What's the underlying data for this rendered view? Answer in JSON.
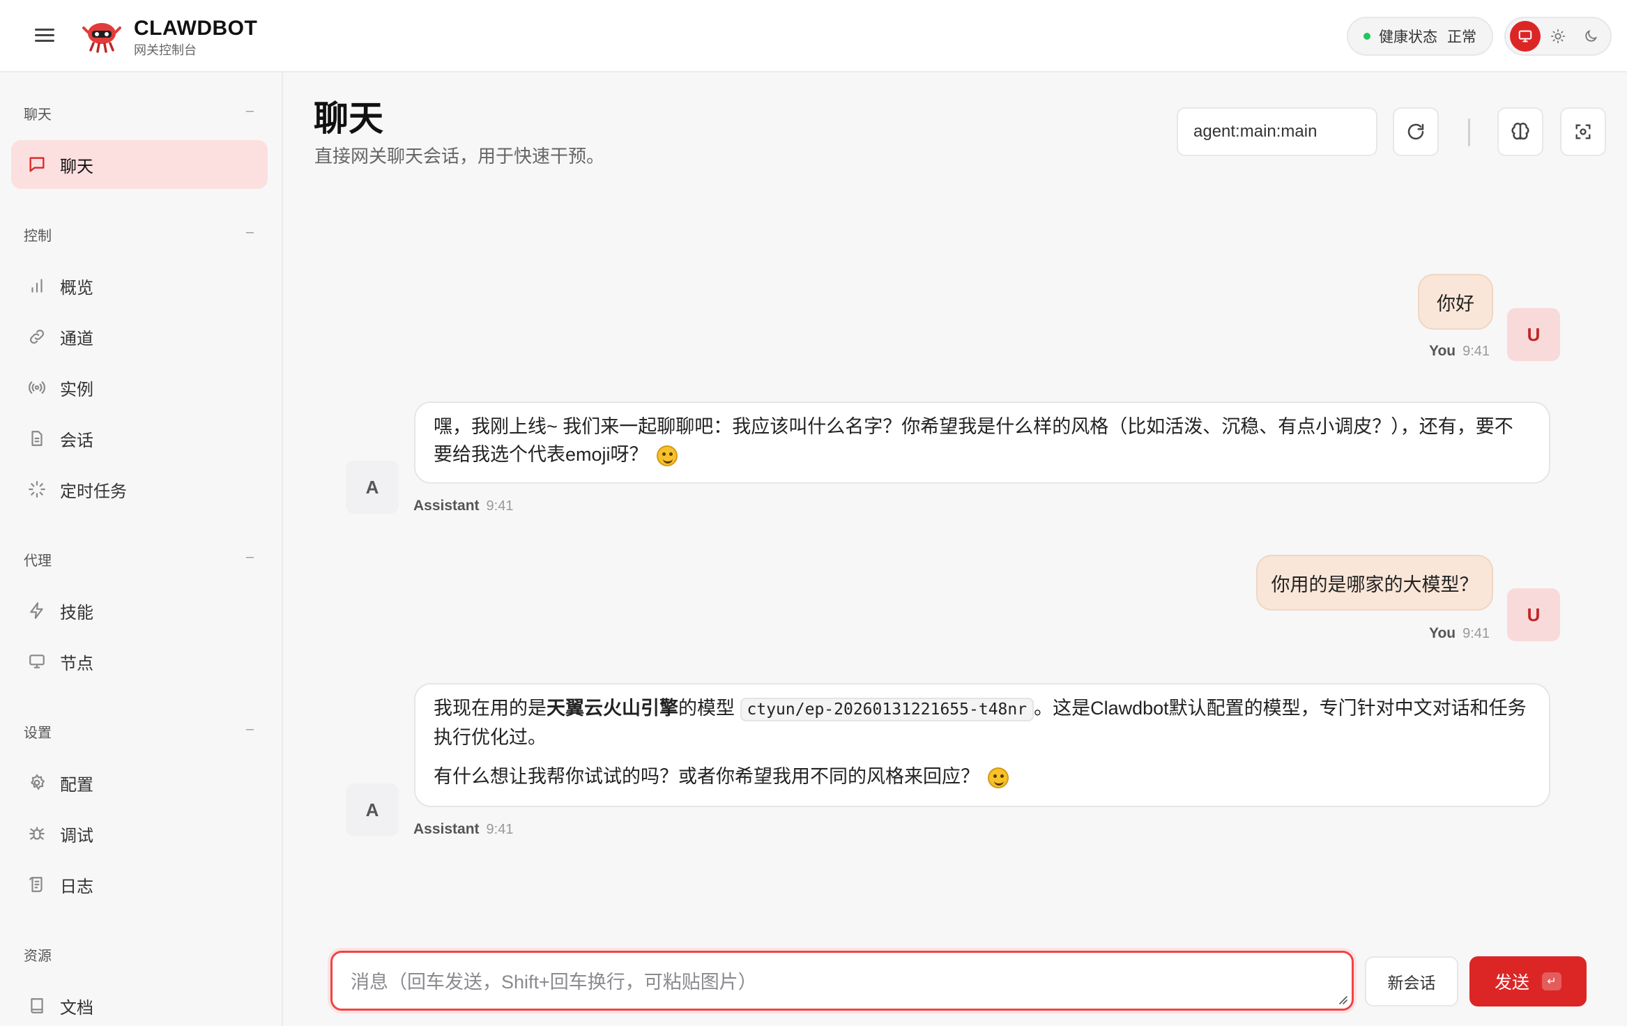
{
  "brand": {
    "title": "CLAWDBOT",
    "subtitle": "网关控制台"
  },
  "health": {
    "label": "健康状态",
    "value": "正常",
    "status_color": "#22c55e"
  },
  "theme": {
    "options": [
      "monitor-icon",
      "sun-icon",
      "moon-icon"
    ],
    "active": "monitor-icon",
    "accent": "#dc2626"
  },
  "sidebar": {
    "sections": [
      {
        "title": "聊天",
        "collapse": "–",
        "items": [
          {
            "label": "聊天",
            "icon": "chat-bubble-icon",
            "active": true
          }
        ]
      },
      {
        "title": "控制",
        "collapse": "–",
        "items": [
          {
            "label": "概览",
            "icon": "bar-chart-icon"
          },
          {
            "label": "通道",
            "icon": "link-icon"
          },
          {
            "label": "实例",
            "icon": "broadcast-icon"
          },
          {
            "label": "会话",
            "icon": "document-icon"
          },
          {
            "label": "定时任务",
            "icon": "loader-icon"
          }
        ]
      },
      {
        "title": "代理",
        "collapse": "–",
        "items": [
          {
            "label": "技能",
            "icon": "lightning-icon"
          },
          {
            "label": "节点",
            "icon": "monitor-icon"
          }
        ]
      },
      {
        "title": "设置",
        "collapse": "–",
        "items": [
          {
            "label": "配置",
            "icon": "gear-icon"
          },
          {
            "label": "调试",
            "icon": "bug-icon"
          },
          {
            "label": "日志",
            "icon": "scroll-icon"
          }
        ]
      },
      {
        "title": "资源",
        "items": [
          {
            "label": "文档",
            "icon": "book-icon"
          }
        ]
      }
    ]
  },
  "main": {
    "title": "聊天",
    "subtitle": "直接网关聊天会话，用于快速干预。",
    "session_key": "agent:main:main",
    "toolbar_icons": [
      "refresh-icon",
      "brain-icon",
      "focus-icon"
    ]
  },
  "messages": [
    {
      "role": "user",
      "text": "你好",
      "who": "You",
      "time": "9:41",
      "avatar": "U"
    },
    {
      "role": "assistant",
      "text": "嘿，我刚上线~ 我们来一起聊聊吧：我应该叫什么名字？你希望我是什么样的风格（比如活泼、沉稳、有点小调皮？），还有，要不要给我选个代表emoji呀？",
      "who": "Assistant",
      "time": "9:41",
      "avatar": "A"
    },
    {
      "role": "user",
      "text": "你用的是哪家的大模型？",
      "who": "You",
      "time": "9:41",
      "avatar": "U"
    },
    {
      "role": "assistant",
      "p1_prefix": "我现在用的是",
      "p1_bold": "天翼云火山引擎",
      "p1_mid": "的模型",
      "p1_code": "ctyun/ep-20260131221655-t48nr",
      "p1_suffix": "。这是Clawdbot默认配置的模型，专门针对中文对话和任务执行优化过。",
      "p2": "有什么想让我帮你试试的吗？或者你希望我用不同的风格来回应？",
      "who": "Assistant",
      "time": "9:41",
      "avatar": "A"
    }
  ],
  "composer": {
    "placeholder": "消息（回车发送，Shift+回车换行，可粘贴图片）",
    "new_session_label": "新会话",
    "send_label": "发送",
    "send_shortcut": "↵"
  }
}
